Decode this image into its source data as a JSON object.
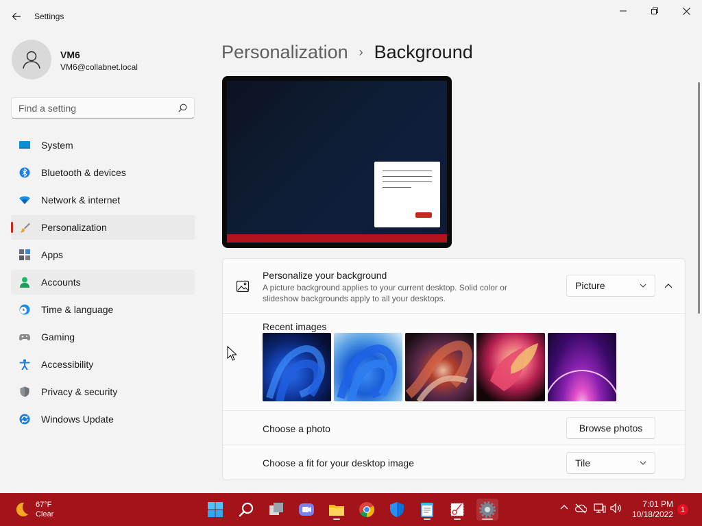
{
  "window": {
    "title": "Settings"
  },
  "profile": {
    "name": "VM6",
    "email": "VM6@collabnet.local"
  },
  "search": {
    "placeholder": "Find a setting"
  },
  "nav": {
    "items": [
      {
        "label": "System",
        "icon": "system-icon"
      },
      {
        "label": "Bluetooth & devices",
        "icon": "bluetooth-icon"
      },
      {
        "label": "Network & internet",
        "icon": "wifi-icon"
      },
      {
        "label": "Personalization",
        "icon": "brush-icon",
        "selected": true
      },
      {
        "label": "Apps",
        "icon": "apps-icon"
      },
      {
        "label": "Accounts",
        "icon": "accounts-icon"
      },
      {
        "label": "Time & language",
        "icon": "globe-clock-icon"
      },
      {
        "label": "Gaming",
        "icon": "gamepad-icon"
      },
      {
        "label": "Accessibility",
        "icon": "accessibility-icon"
      },
      {
        "label": "Privacy & security",
        "icon": "shield-icon"
      },
      {
        "label": "Windows Update",
        "icon": "update-icon"
      }
    ]
  },
  "header": {
    "parent": "Personalization",
    "separator": "›",
    "current": "Background"
  },
  "background_card": {
    "title": "Personalize your background",
    "description": "A picture background applies to your current desktop. Solid color or slideshow backgrounds apply to all your desktops.",
    "selected_type": "Picture",
    "recent_images_label": "Recent images",
    "recent_images": [
      "bloom-dark",
      "bloom-light",
      "swirl-red",
      "flow-pink",
      "glow-purple"
    ],
    "choose_photo_label": "Choose a photo",
    "browse_button": "Browse photos",
    "fit_label": "Choose a fit for your desktop image",
    "fit_value": "Tile"
  },
  "taskbar": {
    "weather_temp": "67°F",
    "weather_cond": "Clear",
    "time": "7:01 PM",
    "date": "10/18/2022",
    "notification_count": "1",
    "apps": [
      "start-icon",
      "search-icon",
      "task-view-icon",
      "teams-chat-icon",
      "file-explorer-icon",
      "chrome-icon",
      "defender-icon",
      "notepad-icon",
      "snipping-tool-icon",
      "settings-icon"
    ],
    "accent_color": "#a3141a"
  },
  "colors": {
    "selection_accent": "#c42b1c",
    "taskbar": "#a3141a"
  }
}
